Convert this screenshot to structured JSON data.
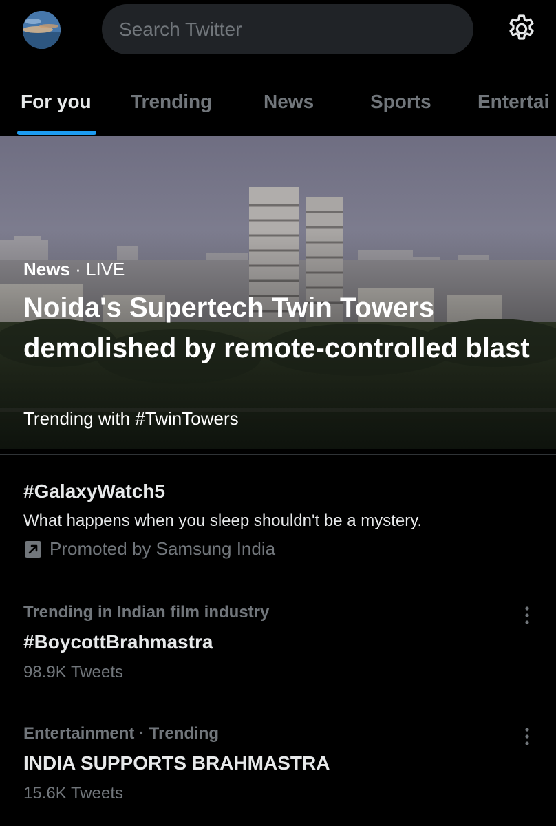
{
  "header": {
    "avatar_icon": "profile-avatar",
    "search_placeholder": "Search Twitter",
    "settings_icon": "gear-icon"
  },
  "tabs": [
    {
      "label": "For you",
      "active": true
    },
    {
      "label": "Trending",
      "active": false
    },
    {
      "label": "News",
      "active": false
    },
    {
      "label": "Sports",
      "active": false
    },
    {
      "label": "Entertai",
      "active": false
    }
  ],
  "hero": {
    "category": "News",
    "separator": " · ",
    "live_label": "LIVE",
    "title": "Noida's Supertech Twin Towers demolished by remote-controlled blast",
    "subtitle": "Trending with #TwinTowers"
  },
  "promoted": {
    "hashtag": "#GalaxyWatch5",
    "description": "What happens when you sleep shouldn't be a mystery.",
    "promoted_by": "Promoted by Samsung India",
    "icon": "promoted-arrow-icon"
  },
  "trends": [
    {
      "context": "Trending in Indian film industry",
      "name": "#BoycottBrahmastra",
      "count": "98.9K Tweets"
    },
    {
      "context": "Entertainment · Trending",
      "name": "INDIA SUPPORTS BRAHMASTRA",
      "count": "15.6K Tweets"
    }
  ],
  "colors": {
    "background": "#000000",
    "accent": "#1d9bf0",
    "primary_text": "#e7e9ea",
    "secondary_text": "#71767b",
    "search_bg": "#202327",
    "divider": "#2f3336"
  }
}
